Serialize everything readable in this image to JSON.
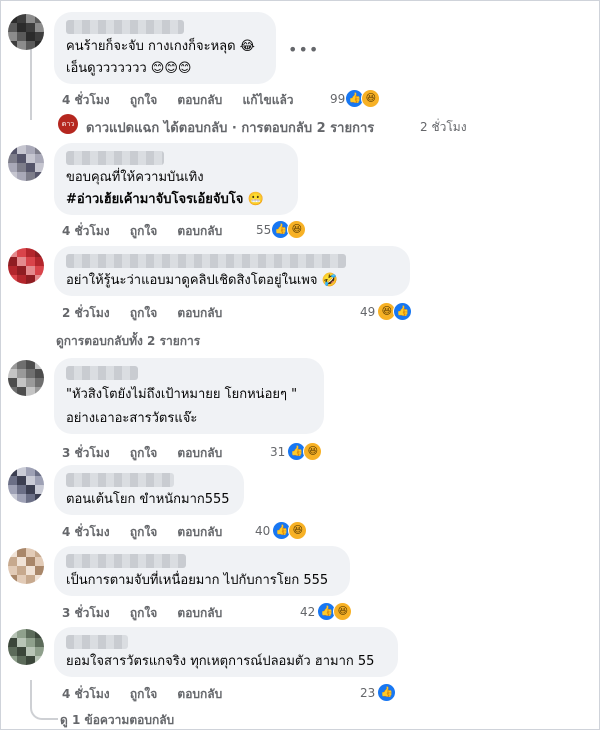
{
  "comments": [
    {
      "id": "c1",
      "lines": [
        "คนร้ายก็จะจับ กางเกงก็จะหลุด 😂",
        "เอ็นดูววววววว 😊😊😊"
      ],
      "actions": {
        "time": "4 ชั่วโมง",
        "like": "ถูกใจ",
        "reply": "ตอบกลับ",
        "edited": "แก้ไขแล้ว"
      },
      "reaction_count": "99",
      "reactions": [
        "like",
        "haha"
      ]
    },
    {
      "id": "c2",
      "lines": [
        "ขอบคุณที่ให้ความบันเทิง",
        "#อ่าวเฮ้ยเค้ามาจับโจรเอ้ยจับโจ 😬"
      ],
      "actions": {
        "time": "4 ชั่วโมง",
        "like": "ถูกใจ",
        "reply": "ตอบกลับ"
      },
      "reaction_count": "55",
      "reactions": [
        "like",
        "haha"
      ]
    },
    {
      "id": "c3",
      "lines": [
        "อย่าให้รู้นะว่าแอบมาดูคลิปเชิดสิงโตอยู่ในเพจ 🤣"
      ],
      "actions": {
        "time": "2 ชั่วโมง",
        "like": "ถูกใจ",
        "reply": "ตอบกลับ"
      },
      "reaction_count": "49",
      "reactions": [
        "haha",
        "like"
      ]
    },
    {
      "id": "c4",
      "lines": [
        "\"หัวสิงโตยังไม่ถึงเป้าหมายย โยกหน่อยๆ \"",
        "อย่างเอาอะสารวัตรแจ๊ะ"
      ],
      "actions": {
        "time": "3 ชั่วโมง",
        "like": "ถูกใจ",
        "reply": "ตอบกลับ"
      },
      "reaction_count": "31",
      "reactions": [
        "like",
        "haha"
      ]
    },
    {
      "id": "c5",
      "lines": [
        "ตอนเต้นโยก ขำหนักมาก555"
      ],
      "actions": {
        "time": "4 ชั่วโมง",
        "like": "ถูกใจ",
        "reply": "ตอบกลับ"
      },
      "reaction_count": "40",
      "reactions": [
        "like",
        "haha"
      ]
    },
    {
      "id": "c6",
      "lines": [
        "เป็นการตามจับที่เหนื่อยมาก ไปกับการโยก 555"
      ],
      "actions": {
        "time": "3 ชั่วโมง",
        "like": "ถูกใจ",
        "reply": "ตอบกลับ"
      },
      "reaction_count": "42",
      "reactions": [
        "like",
        "haha"
      ]
    },
    {
      "id": "c7",
      "lines": [
        "ยอมใจสารวัตรแกจริง ทุกเหตุการณ์ปลอมตัว ฮามาก 55"
      ],
      "actions": {
        "time": "4 ชั่วโมง",
        "like": "ถูกใจ",
        "reply": "ตอบกลับ"
      },
      "reaction_count": "23",
      "reactions": [
        "like"
      ]
    }
  ],
  "page_reply": {
    "name": "ดาวแปดแฉก",
    "text": "ได้ตอบกลับ · การตอบกลับ 2 รายการ",
    "time": "2 ชั่วโมง",
    "avatar_text": "ดาว"
  },
  "view_replies": "ดูการตอบกลับทั้ง 2 รายการ",
  "view_one_reply": "ดู 1 ข้อความตอบกลับ",
  "more_icon": "•••",
  "colors": {
    "bubble": "#f0f2f5",
    "like": "#1877f2",
    "haha": "#f7b125",
    "muted": "#65676b"
  }
}
